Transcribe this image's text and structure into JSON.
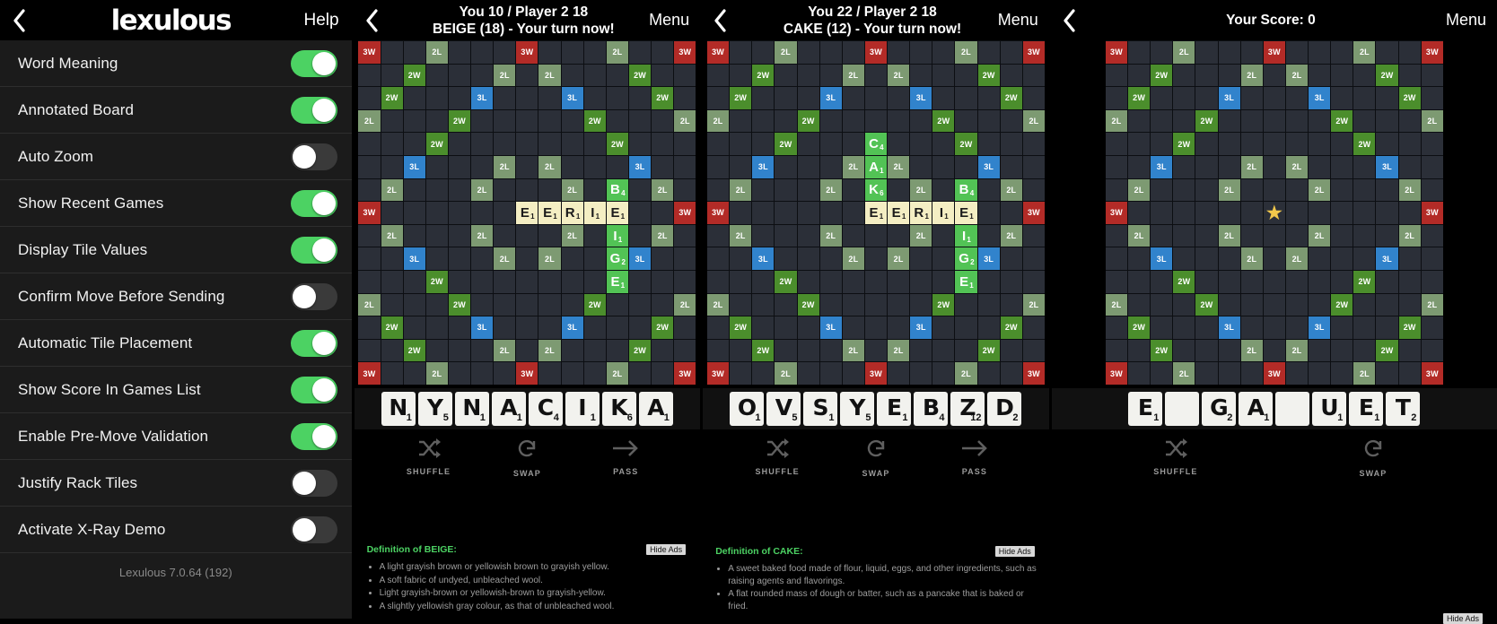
{
  "settings": {
    "header": {
      "back_icon": "chevron-left-icon",
      "brand": "lexulous",
      "trademark": "™",
      "help_label": "Help"
    },
    "rows": [
      {
        "label": "Word Meaning",
        "state": "on"
      },
      {
        "label": "Annotated Board",
        "state": "on"
      },
      {
        "label": "Auto Zoom",
        "state": "off"
      },
      {
        "label": "Show Recent Games",
        "state": "on"
      },
      {
        "label": "Display Tile Values",
        "state": "on"
      },
      {
        "label": "Confirm Move Before Sending",
        "state": "off"
      },
      {
        "label": "Automatic Tile Placement",
        "state": "on"
      },
      {
        "label": "Show Score In Games List",
        "state": "on"
      },
      {
        "label": "Enable Pre-Move Validation",
        "state": "on"
      },
      {
        "label": "Justify Rack Tiles",
        "state": "off"
      },
      {
        "label": "Activate X-Ray Demo",
        "state": "off"
      }
    ],
    "version": "Lexulous 7.0.64 (192)"
  },
  "colors": {
    "triple_word": "#b32b27",
    "double_word": "#4b8e2c",
    "double_letter": "#7d9a72",
    "triple_letter": "#3183cc",
    "empty_cell": "#2b2f38",
    "tile_board": "#52c355",
    "tile_pending": "#f4eec3",
    "toggle_on": "#4cd263",
    "toggle_off": "#3a3a3a",
    "accent_green": "#4cd263",
    "star": "#f2c84b"
  },
  "bonus_layout": [
    [
      "3W",
      "",
      "",
      "2L",
      "",
      "",
      "",
      "3W",
      "",
      "",
      "",
      "2L",
      "",
      "",
      "3W"
    ],
    [
      "",
      "",
      "2W",
      "",
      "",
      "",
      "2L",
      "",
      "2L",
      "",
      "",
      "",
      "2W",
      "",
      ""
    ],
    [
      "",
      "2W",
      "",
      "",
      "",
      "3L",
      "",
      "",
      "",
      "3L",
      "",
      "",
      "",
      "2W",
      ""
    ],
    [
      "2L",
      "",
      "",
      "",
      "2W",
      "",
      "",
      "",
      "",
      "",
      "2W",
      "",
      "",
      "",
      "2L"
    ],
    [
      "",
      "",
      "",
      "2W",
      "",
      "",
      "",
      "",
      "",
      "",
      "",
      "2W",
      "",
      "",
      ""
    ],
    [
      "",
      "",
      "3L",
      "",
      "",
      "",
      "2L",
      "",
      "2L",
      "",
      "",
      "",
      "3L",
      "",
      ""
    ],
    [
      "",
      "2L",
      "",
      "",
      "",
      "2L",
      "",
      "",
      "",
      "2L",
      "",
      "",
      "",
      "2L",
      ""
    ],
    [
      "3W",
      "",
      "",
      "",
      "",
      "",
      "",
      "",
      "",
      "",
      "",
      "",
      "",
      "",
      "3W"
    ],
    [
      "",
      "2L",
      "",
      "",
      "",
      "2L",
      "",
      "",
      "",
      "2L",
      "",
      "",
      "",
      "2L",
      ""
    ],
    [
      "",
      "",
      "3L",
      "",
      "",
      "",
      "2L",
      "",
      "2L",
      "",
      "",
      "",
      "3L",
      "",
      ""
    ],
    [
      "",
      "",
      "",
      "2W",
      "",
      "",
      "",
      "",
      "",
      "",
      "",
      "2W",
      "",
      "",
      ""
    ],
    [
      "2L",
      "",
      "",
      "",
      "2W",
      "",
      "",
      "",
      "",
      "",
      "2W",
      "",
      "",
      "",
      "2L"
    ],
    [
      "",
      "2W",
      "",
      "",
      "",
      "3L",
      "",
      "",
      "",
      "3L",
      "",
      "",
      "",
      "2W",
      ""
    ],
    [
      "",
      "",
      "2W",
      "",
      "",
      "",
      "2L",
      "",
      "2L",
      "",
      "",
      "",
      "2W",
      "",
      ""
    ],
    [
      "3W",
      "",
      "",
      "2L",
      "",
      "",
      "",
      "3W",
      "",
      "",
      "",
      "2L",
      "",
      "",
      "3W"
    ]
  ],
  "game1": {
    "header": {
      "back_icon": "chevron-left-icon",
      "score_line": "You 10 / Player 2 18",
      "word_line": "BEIGE (18) - Your turn now!",
      "menu_label": "Menu"
    },
    "board_tiles": [
      {
        "row": 6,
        "col": 11,
        "letter": "B",
        "value": "4",
        "kind": "board"
      },
      {
        "row": 7,
        "col": 7,
        "letter": "E",
        "value": "1",
        "kind": "pending"
      },
      {
        "row": 7,
        "col": 8,
        "letter": "E",
        "value": "1",
        "kind": "pending"
      },
      {
        "row": 7,
        "col": 9,
        "letter": "R",
        "value": "1",
        "kind": "pending"
      },
      {
        "row": 7,
        "col": 10,
        "letter": "I",
        "value": "1",
        "kind": "pending"
      },
      {
        "row": 7,
        "col": 11,
        "letter": "E",
        "value": "1",
        "kind": "pending"
      },
      {
        "row": 8,
        "col": 11,
        "letter": "I",
        "value": "1",
        "kind": "board"
      },
      {
        "row": 9,
        "col": 11,
        "letter": "G",
        "value": "2",
        "kind": "board"
      },
      {
        "row": 10,
        "col": 11,
        "letter": "E",
        "value": "1",
        "kind": "board"
      }
    ],
    "rack": [
      {
        "letter": "N",
        "value": "1"
      },
      {
        "letter": "Y",
        "value": "5"
      },
      {
        "letter": "N",
        "value": "1"
      },
      {
        "letter": "A",
        "value": "1"
      },
      {
        "letter": "C",
        "value": "4"
      },
      {
        "letter": "I",
        "value": "1"
      },
      {
        "letter": "K",
        "value": "6"
      },
      {
        "letter": "A",
        "value": "1"
      }
    ],
    "actions": [
      {
        "label": "SHUFFLE",
        "icon": "shuffle-icon"
      },
      {
        "label": "SWAP",
        "icon": "swap-icon"
      },
      {
        "label": "PASS",
        "icon": "arrow-right-icon"
      }
    ],
    "definition": {
      "title": "Definition of BEIGE:",
      "items": [
        "A light grayish brown or yellowish brown to grayish yellow.",
        "A soft fabric of undyed, unbleached wool.",
        "Light grayish-brown or yellowish-brown to grayish-yellow.",
        "A slightly yellowish gray colour, as that of unbleached wool."
      ],
      "hide_ads": "Hide Ads"
    }
  },
  "game2": {
    "header": {
      "back_icon": "chevron-left-icon",
      "score_line": "You 22 / Player 2 18",
      "word_line": "CAKE (12) - Your turn now!",
      "menu_label": "Menu"
    },
    "board_tiles": [
      {
        "row": 4,
        "col": 7,
        "letter": "C",
        "value": "4",
        "kind": "board"
      },
      {
        "row": 5,
        "col": 7,
        "letter": "A",
        "value": "1",
        "kind": "board"
      },
      {
        "row": 6,
        "col": 7,
        "letter": "K",
        "value": "6",
        "kind": "board"
      },
      {
        "row": 6,
        "col": 11,
        "letter": "B",
        "value": "4",
        "kind": "board"
      },
      {
        "row": 7,
        "col": 7,
        "letter": "E",
        "value": "1",
        "kind": "pending"
      },
      {
        "row": 7,
        "col": 8,
        "letter": "E",
        "value": "1",
        "kind": "pending"
      },
      {
        "row": 7,
        "col": 9,
        "letter": "R",
        "value": "1",
        "kind": "pending"
      },
      {
        "row": 7,
        "col": 10,
        "letter": "I",
        "value": "1",
        "kind": "pending"
      },
      {
        "row": 7,
        "col": 11,
        "letter": "E",
        "value": "1",
        "kind": "pending"
      },
      {
        "row": 8,
        "col": 11,
        "letter": "I",
        "value": "1",
        "kind": "board"
      },
      {
        "row": 9,
        "col": 11,
        "letter": "G",
        "value": "2",
        "kind": "board"
      },
      {
        "row": 10,
        "col": 11,
        "letter": "E",
        "value": "1",
        "kind": "board"
      }
    ],
    "rack": [
      {
        "letter": "O",
        "value": "1"
      },
      {
        "letter": "V",
        "value": "5"
      },
      {
        "letter": "S",
        "value": "1"
      },
      {
        "letter": "Y",
        "value": "5"
      },
      {
        "letter": "E",
        "value": "1"
      },
      {
        "letter": "B",
        "value": "4"
      },
      {
        "letter": "Z",
        "value": "12"
      },
      {
        "letter": "D",
        "value": "2"
      }
    ],
    "actions": [
      {
        "label": "SHUFFLE",
        "icon": "shuffle-icon"
      },
      {
        "label": "SWAP",
        "icon": "swap-icon"
      },
      {
        "label": "PASS",
        "icon": "arrow-right-icon"
      }
    ],
    "definition": {
      "title": "Definition of CAKE:",
      "items": [
        "A sweet baked food made of flour, liquid, eggs, and other ingredients, such as raising agents and flavorings.",
        "A flat rounded mass of dough or batter, such as a pancake that is baked or fried."
      ],
      "hide_ads": "Hide Ads"
    }
  },
  "game3": {
    "header": {
      "back_icon": "chevron-left-icon",
      "score_line": "Your Score: 0",
      "menu_label": "Menu"
    },
    "center_star": {
      "row": 7,
      "col": 7,
      "icon": "star-icon"
    },
    "rack": [
      {
        "letter": "E",
        "value": "1"
      },
      {
        "letter": "",
        "value": ""
      },
      {
        "letter": "G",
        "value": "2"
      },
      {
        "letter": "A",
        "value": "1"
      },
      {
        "letter": "",
        "value": ""
      },
      {
        "letter": "U",
        "value": "1"
      },
      {
        "letter": "E",
        "value": "1"
      },
      {
        "letter": "T",
        "value": "2"
      }
    ],
    "actions": [
      {
        "label": "SHUFFLE",
        "icon": "shuffle-icon"
      },
      {
        "label": "SWAP",
        "icon": "swap-icon"
      }
    ],
    "hide_ads": "Hide Ads"
  }
}
